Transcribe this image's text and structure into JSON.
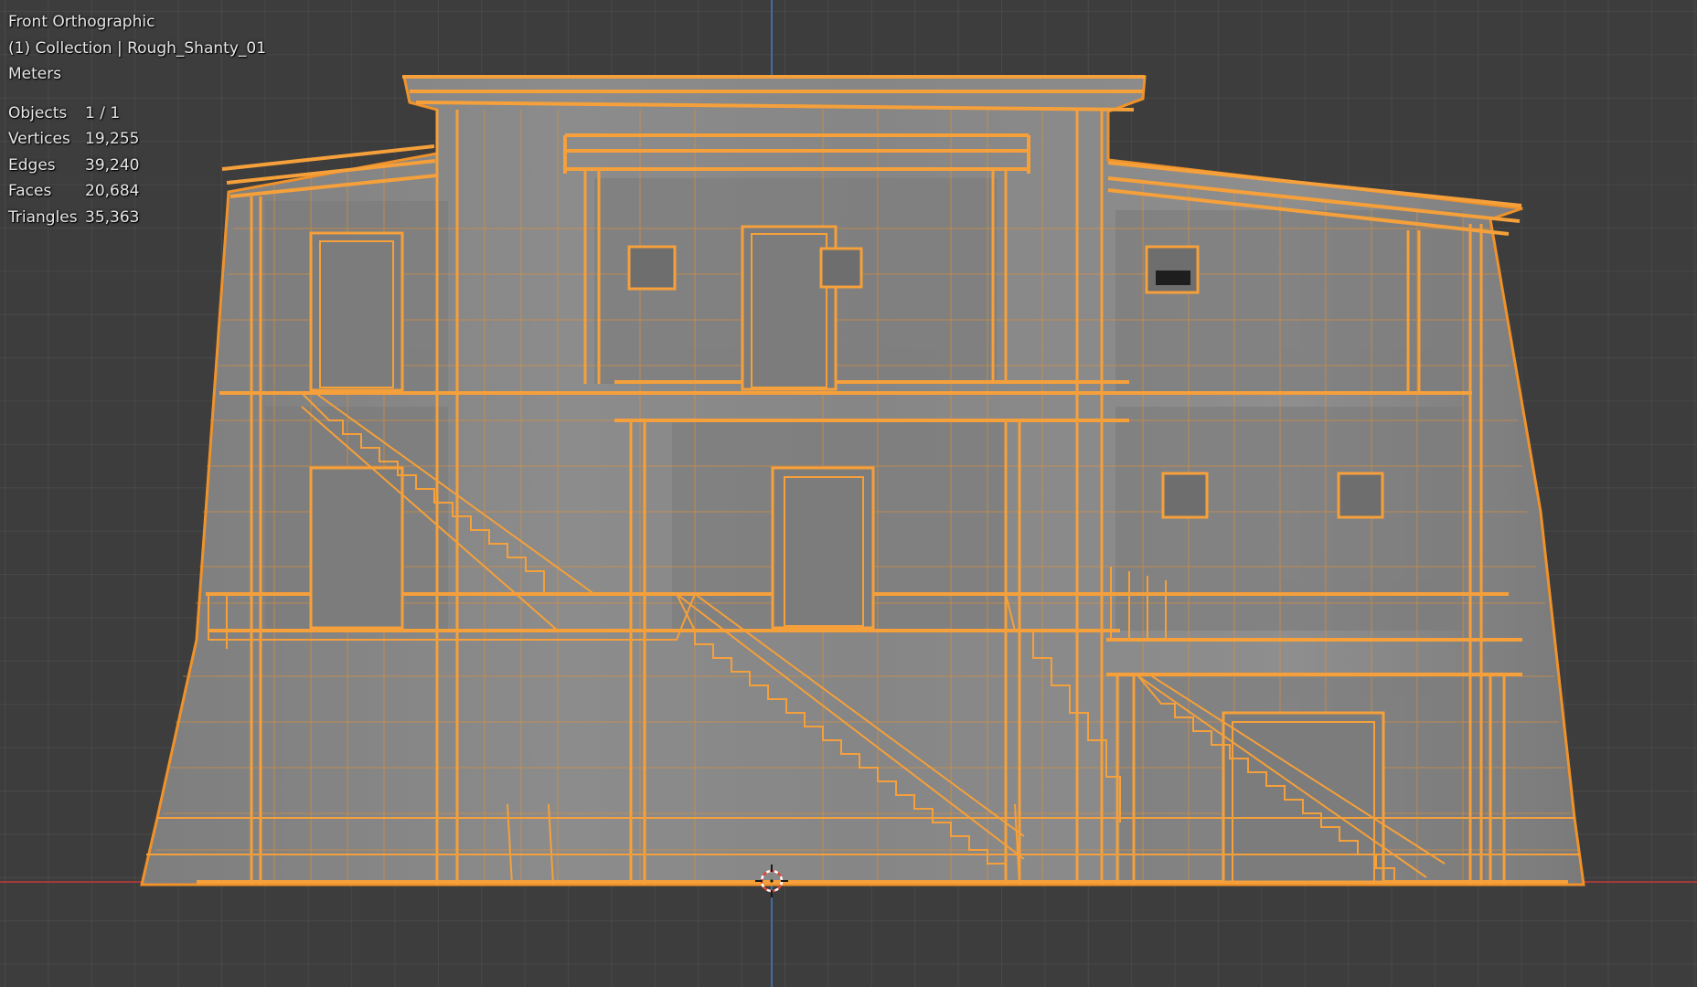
{
  "viewport": {
    "view_name": "Front Orthographic",
    "collection_line": "(1) Collection | Rough_Shanty_01",
    "units": "Meters",
    "stats": [
      {
        "label": "Objects",
        "value": "1 / 1"
      },
      {
        "label": "Vertices",
        "value": "19,255"
      },
      {
        "label": "Edges",
        "value": "39,240"
      },
      {
        "label": "Faces",
        "value": "20,684"
      },
      {
        "label": "Triangles",
        "value": "35,363"
      }
    ]
  },
  "colors": {
    "background": "#3d3d3d",
    "mesh_fill": "#8a8a8a",
    "wire_selected": "#f0922a",
    "x_axis": "#a33b3b",
    "y_axis": "#3e6ea3",
    "cursor": "#d94a3a"
  },
  "icons": {
    "cursor": "3d-cursor-icon"
  }
}
